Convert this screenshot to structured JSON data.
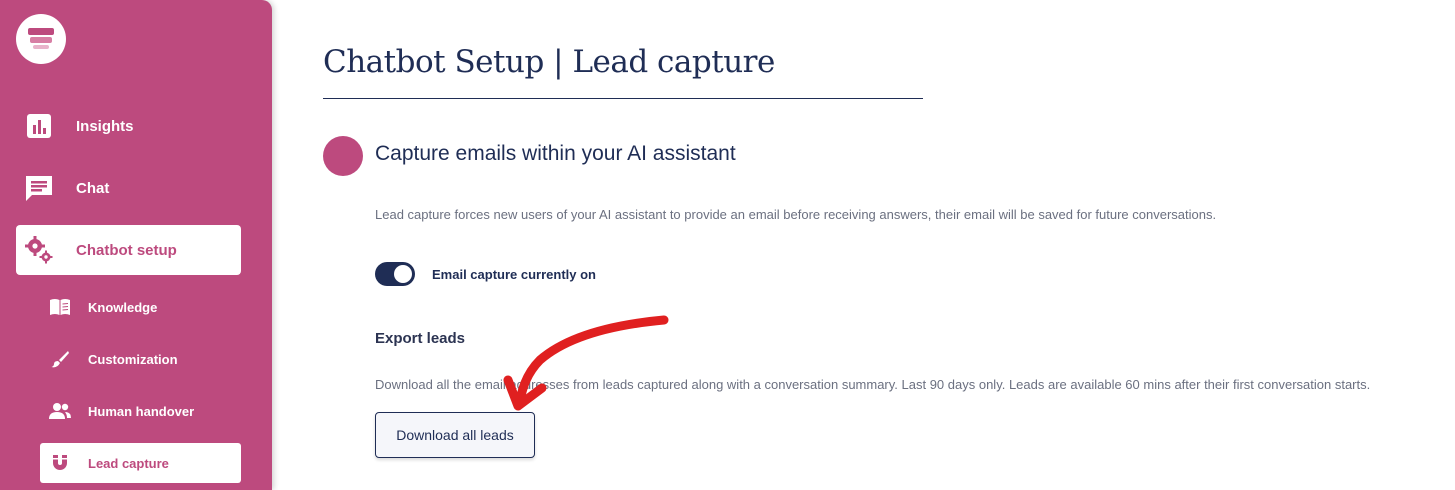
{
  "sidebar": {
    "logo": "logo",
    "items": [
      {
        "label": "Insights",
        "icon": "bar-chart-icon"
      },
      {
        "label": "Chat",
        "icon": "chat-icon"
      },
      {
        "label": "Chatbot setup",
        "icon": "gears-icon",
        "active": true
      }
    ],
    "subitems": [
      {
        "label": "Knowledge",
        "icon": "book-icon"
      },
      {
        "label": "Customization",
        "icon": "brush-icon"
      },
      {
        "label": "Human handover",
        "icon": "users-icon"
      },
      {
        "label": "Lead capture",
        "icon": "magnet-icon",
        "active": true
      }
    ]
  },
  "main": {
    "title": "Chatbot Setup | Lead capture",
    "section_title": "Capture emails within your AI assistant",
    "description": "Lead capture forces new users of your AI assistant to provide an email before receiving answers, their email will be saved for future conversations.",
    "toggle": {
      "state": "on",
      "label": "Email capture currently on"
    },
    "export": {
      "title": "Export leads",
      "description": "Download all the email addresses from leads captured along with a conversation summary. Last 90 days only. Leads are available 60 mins after their first conversation starts.",
      "button_label": "Download all leads"
    }
  },
  "annotation": {
    "type": "hand-drawn-arrow",
    "color": "#e02020"
  },
  "colors": {
    "sidebar": "#bd4a7e",
    "navy": "#1f2d55",
    "muted_text": "#6b7080"
  }
}
